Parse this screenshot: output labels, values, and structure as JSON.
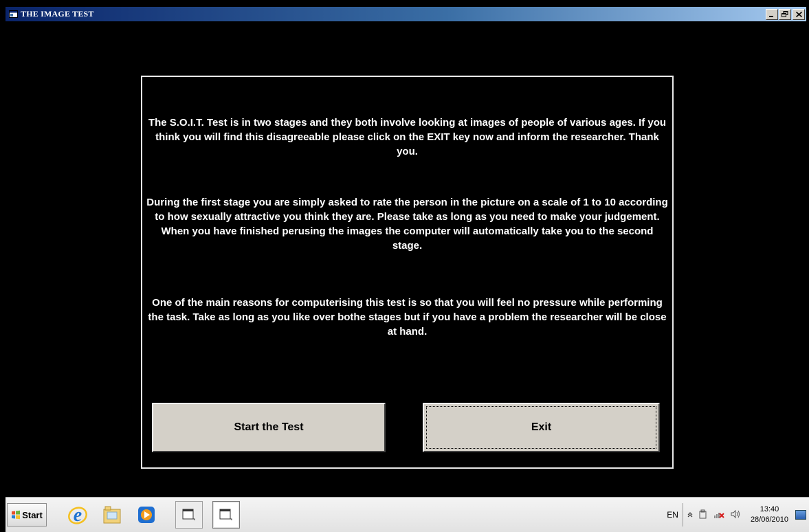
{
  "window": {
    "title": "THE IMAGE TEST",
    "controls": {
      "minimize": "_",
      "maximize": "🗗",
      "close": "✕"
    }
  },
  "content": {
    "paragraph_1": "The S.O.I.T. Test is in two stages and they both involve looking at images of people of various ages. If you think you will find this disagreeable please click on the EXIT key now and inform the researcher.  Thank you.",
    "paragraph_2": "During the first stage you are simply asked to rate the person in the picture on a scale of 1 to 10 according to how sexually attractive you think they are. Please take as long as you need to make your judgement. When you have finished perusing the images the computer will automatically take you to the second stage.",
    "paragraph_3": "One of the main reasons for computerising this test is so that you will feel no pressure while performing the task.  Take as long as you like over bothe stages but if you have a problem the researcher will be close at hand.",
    "start_button": "Start the Test",
    "exit_button": "Exit"
  },
  "taskbar": {
    "start_label": "Start",
    "pinned": [
      "internet-explorer-icon",
      "file-explorer-icon",
      "media-player-icon"
    ],
    "windows": [
      "window-1",
      "window-2"
    ],
    "tray": {
      "language": "EN",
      "time": "13:40",
      "date": "28/06/2010"
    }
  },
  "colors": {
    "titlebar_start": "#0a246a",
    "titlebar_end": "#a6caf0",
    "button_face": "#d4d0c8",
    "background": "#000000",
    "text": "#ffffff"
  }
}
